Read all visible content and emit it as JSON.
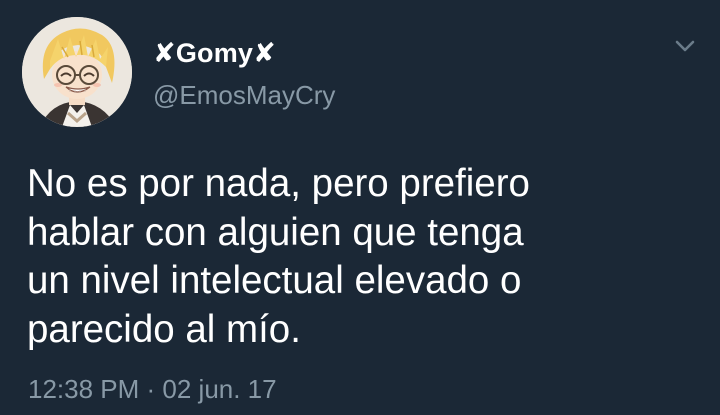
{
  "tweet": {
    "author": {
      "display_name": "✘Gomy✘",
      "handle": "@EmosMayCry",
      "avatar_icon": "anime-avatar"
    },
    "text_lines": [
      "No es por nada, pero prefiero",
      "hablar con alguien que tenga",
      "un nivel intelectual elevado o",
      "parecido al mío."
    ],
    "timestamp": "12:38 PM · 02 jun. 17",
    "menu_icon": "chevron-down-icon"
  },
  "colors": {
    "background": "#1b2836",
    "primary_text": "#ffffff",
    "secondary_text": "#8899a6"
  }
}
